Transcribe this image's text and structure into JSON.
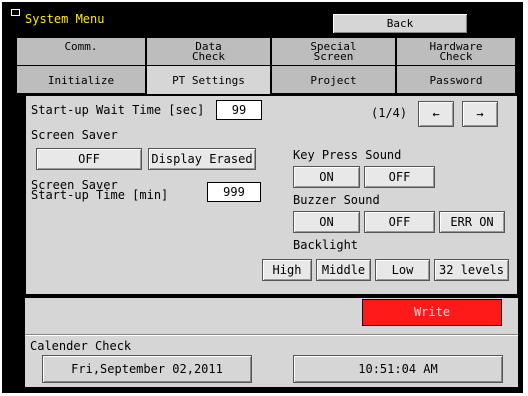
{
  "window": {
    "title": "System Menu",
    "back_label": "Back"
  },
  "tabs_row1": [
    {
      "lines": [
        "Comm.",
        ""
      ]
    },
    {
      "lines": [
        "Data",
        "Check"
      ]
    },
    {
      "lines": [
        "Special",
        "Screen"
      ]
    },
    {
      "lines": [
        "Hardware",
        "Check"
      ]
    }
  ],
  "tabs_row2": [
    {
      "label": "Initialize"
    },
    {
      "label": "PT Settings"
    },
    {
      "label": "Project"
    },
    {
      "label": "Password"
    }
  ],
  "settings": {
    "startup_wait_label": "Start-up Wait Time [sec]",
    "startup_wait_value": "99",
    "page_indicator": "(1/4)",
    "prev_icon": "←",
    "next_icon": "→",
    "screen_saver_label": "Screen Saver",
    "screen_saver_off": "OFF",
    "screen_saver_display_erased": "Display Erased",
    "ss_time_label_1": "Screen Saver",
    "ss_time_label_2": "Start-up Time [min]",
    "ss_time_value": "999",
    "key_press_label": "Key Press Sound",
    "key_press_on": "ON",
    "key_press_off": "OFF",
    "buzzer_label": "Buzzer Sound",
    "buzzer_on": "ON",
    "buzzer_off": "OFF",
    "buzzer_err_on": "ERR ON",
    "backlight_label": "Backlight",
    "backlight_high": "High",
    "backlight_middle": "Middle",
    "backlight_low": "Low",
    "backlight_32": "32 levels",
    "write_label": "Write"
  },
  "calendar": {
    "label": "Calender Check",
    "date": "Fri,September 02,2011",
    "time": "10:51:04 AM"
  },
  "colors": {
    "title_text": "#ffea00",
    "write_bg": "#ff1a1a",
    "panel": "#d6d6d6"
  }
}
